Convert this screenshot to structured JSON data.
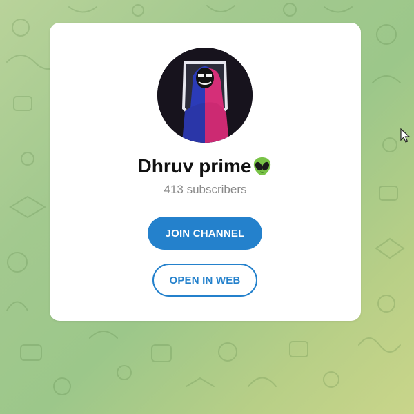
{
  "channel": {
    "name": "Dhruv prime",
    "subscribers": "413 subscribers"
  },
  "actions": {
    "join_label": "JOIN CHANNEL",
    "web_label": "OPEN IN WEB"
  },
  "icons": {
    "title_emoji": "alien-icon",
    "cursor": "mouse-pointer-icon"
  },
  "colors": {
    "accent": "#2481cc",
    "background_green": "#a3c98f",
    "card": "#ffffff",
    "subtext": "#8a8a8a"
  }
}
